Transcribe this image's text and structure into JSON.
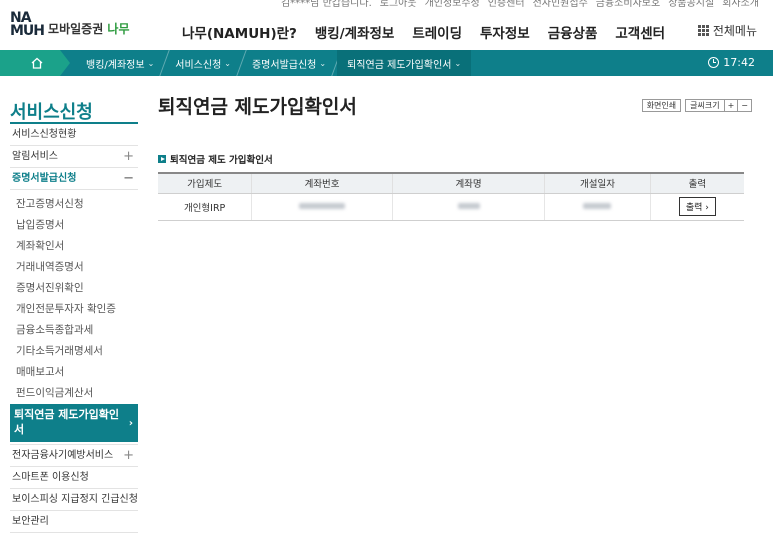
{
  "utility": {
    "greeting": "김****님 반갑습니다.",
    "logout": "로그아웃",
    "links": [
      "개인정보수정",
      "인증센터",
      "전자민원접수",
      "금융소비자보호",
      "상품공시실",
      "회사소개"
    ]
  },
  "header": {
    "logo_top": "NA",
    "logo_bottom": "MUH",
    "logo_label_gray": "모바일증권",
    "logo_label_green": "나무",
    "nav": [
      "나무(NAMUH)란?",
      "뱅킹/계좌정보",
      "트레이딩",
      "투자정보",
      "금융상품",
      "고객센터"
    ],
    "all_menu": "전체메뉴"
  },
  "breadcrumb": {
    "items": [
      "뱅킹/계좌정보",
      "서비스신청",
      "증명서발급신청",
      "퇴직연금 제도가입확인서"
    ],
    "time": "17:42"
  },
  "sidebar": {
    "title": "서비스신청",
    "items_before": [
      {
        "label": "서비스신청현황",
        "expandable": false
      },
      {
        "label": "알림서비스",
        "expandable": true
      }
    ],
    "open_item": {
      "label": "증명서발급신청",
      "toggle": "−"
    },
    "sub_items": [
      "잔고증명서신청",
      "납입증명서",
      "계좌확인서",
      "거래내역증명서",
      "증명서진위확인",
      "개인전문투자자 확인증",
      "금융소득종합과세",
      "기타소득거래명세서",
      "매매보고서",
      "펀드이익금계산서"
    ],
    "active_sub": "퇴직연금 제도가입확인서",
    "items_after": [
      {
        "label": "전자금융사기예방서비스",
        "expandable": true
      },
      {
        "label": "스마트폰 이용신청",
        "expandable": false
      },
      {
        "label": "보이스피싱 지급정지 긴급신청",
        "expandable": false
      },
      {
        "label": "보안관리",
        "expandable": false
      }
    ]
  },
  "main": {
    "title": "퇴직연금 제도가입확인서",
    "tools": {
      "print_screen": "화면인쇄",
      "font_size": "글씨크기",
      "plus": "+",
      "minus": "−"
    },
    "section_title": "퇴직연금 제도 가입확인서",
    "table": {
      "headers": [
        "가입제도",
        "계좌번호",
        "계좌명",
        "개설일자",
        "출력"
      ],
      "rows": [
        {
          "type": "개인형IRP",
          "print": "출력 ›"
        }
      ]
    }
  },
  "colors": {
    "primary": "#0e7f8a",
    "accent": "#1ba28a",
    "brand_green": "#2e9b3f"
  }
}
